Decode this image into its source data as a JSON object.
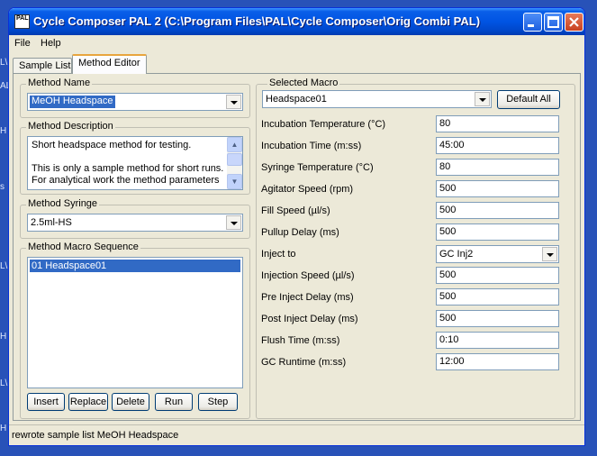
{
  "window": {
    "title": "Cycle Composer  PAL 2  (C:\\Program Files\\PAL\\Cycle Composer\\Orig Combi PAL)",
    "icon_label": "PAL"
  },
  "menu": [
    "File",
    "Help"
  ],
  "tabs": [
    {
      "label": "Sample List",
      "active": false
    },
    {
      "label": "Method Editor",
      "active": true
    }
  ],
  "method_name": {
    "label": "Method Name",
    "value": "MeOH Headspace"
  },
  "method_description": {
    "label": "Method Description",
    "lines": [
      "Short headspace method for testing.",
      "",
      "This is only a sample method for short runs.",
      "For analytical work the method parameters"
    ]
  },
  "method_syringe": {
    "label": "Method Syringe",
    "value": "2.5ml-HS"
  },
  "macro_sequence": {
    "label": "Method Macro Sequence",
    "items": [
      "01 Headspace01"
    ],
    "buttons": [
      "Insert",
      "Replace",
      "Delete",
      "Run",
      "Step"
    ]
  },
  "selected_macro": {
    "label": "Selected Macro",
    "value": "Headspace01",
    "default_button": "Default All",
    "params": [
      {
        "label": "Incubation Temperature  (°C)",
        "value": "80"
      },
      {
        "label": "Incubation Time  (m:ss)",
        "value": "45:00"
      },
      {
        "label": "Syringe Temperature  (°C)",
        "value": "80"
      },
      {
        "label": "Agitator Speed  (rpm)",
        "value": "500"
      },
      {
        "label": "Fill Speed  (µl/s)",
        "value": "500"
      },
      {
        "label": "Pullup Delay  (ms)",
        "value": "500"
      },
      {
        "label": "Inject to",
        "value": "GC Inj2"
      },
      {
        "label": "Injection Speed  (µl/s)",
        "value": "500"
      },
      {
        "label": "Pre Inject Delay  (ms)",
        "value": "500"
      },
      {
        "label": "Post Inject Delay  (ms)",
        "value": "500"
      },
      {
        "label": "Flush Time  (m:ss)",
        "value": "0:10"
      },
      {
        "label": "GC Runtime  (m:ss)",
        "value": "12:00"
      }
    ]
  },
  "status": "rewrote sample list MeOH Headspace",
  "desktop_fragments": [
    "L\\",
    "AL",
    "H",
    "s",
    "L\\",
    "H",
    "L\\",
    "H"
  ]
}
